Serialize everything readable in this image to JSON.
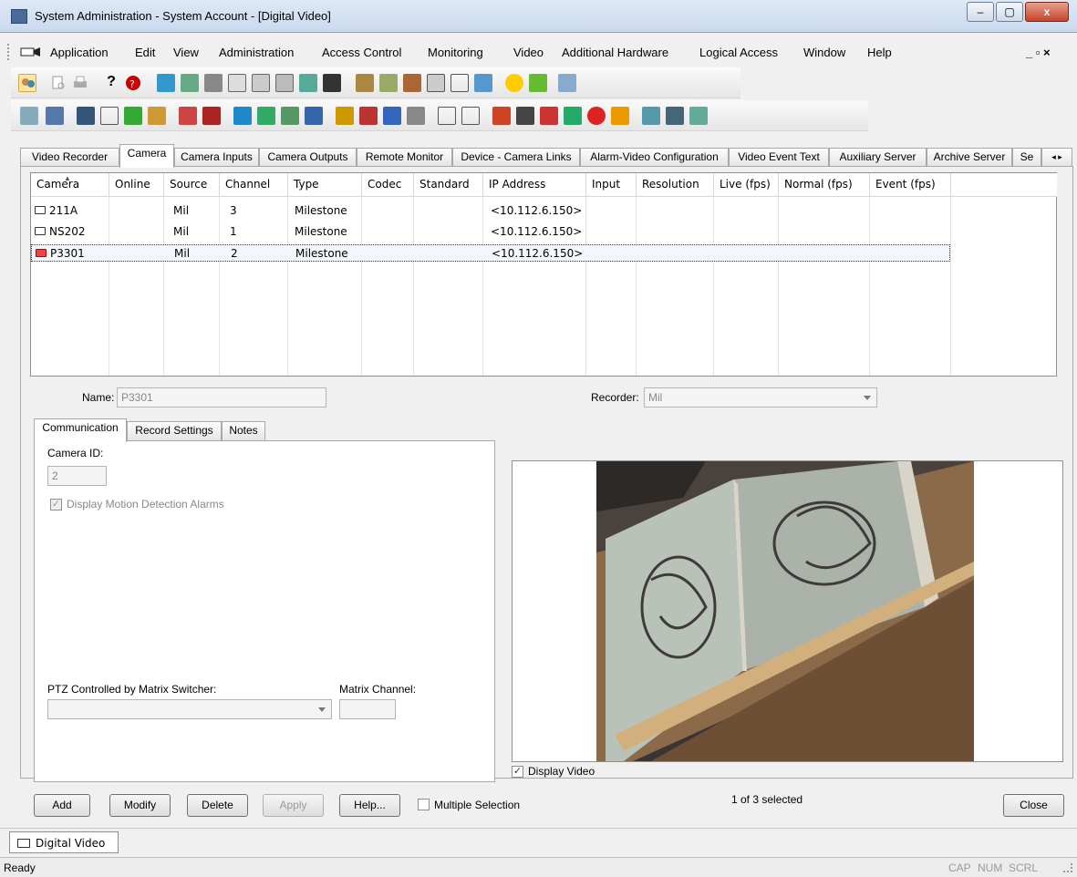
{
  "window": {
    "title": "System Administration - System Account - [Digital Video]",
    "minimize": "–",
    "maximize": "▢",
    "close": "x",
    "mdi_controls": "_ ▫ ×"
  },
  "menu": [
    "Application",
    "Edit",
    "View",
    "Administration",
    "Access Control",
    "Monitoring",
    "Video",
    "Additional Hardware",
    "Logical Access",
    "Window",
    "Help"
  ],
  "tabs": [
    "Video Recorder",
    "Camera",
    "Camera Inputs",
    "Camera Outputs",
    "Remote Monitor",
    "Device - Camera Links",
    "Alarm-Video Configuration",
    "Video Event Text",
    "Auxiliary Server",
    "Archive Server",
    "Se"
  ],
  "tab_scroll": "◂ ▸",
  "grid": {
    "columns": [
      "Camera",
      "Online",
      "Source",
      "Channel",
      "Type",
      "Codec",
      "Standard",
      "IP Address",
      "Input",
      "Resolution",
      "Live (fps)",
      "Normal (fps)",
      "Event (fps)"
    ],
    "rows": [
      {
        "camera": "211A",
        "source": "Mil",
        "channel": "3",
        "type": "Milestone",
        "ip": "<10.112.6.150>",
        "error": false
      },
      {
        "camera": "NS202",
        "source": "Mil",
        "channel": "1",
        "type": "Milestone",
        "ip": "<10.112.6.150>",
        "error": false
      },
      {
        "camera": "P3301",
        "source": "Mil",
        "channel": "2",
        "type": "Milestone",
        "ip": "<10.112.6.150>",
        "error": true
      }
    ]
  },
  "form": {
    "name_label": "Name:",
    "name_value": "P3301",
    "recorder_label": "Recorder:",
    "recorder_value": "Mil",
    "subtabs": [
      "Communication",
      "Record Settings",
      "Notes"
    ],
    "camera_id_label": "Camera ID:",
    "camera_id_value": "2",
    "motion_alarms_label": "Display Motion Detection Alarms",
    "motion_alarms_checked": true,
    "ptz_label": "PTZ Controlled by Matrix Switcher:",
    "matrix_channel_label": "Matrix Channel:",
    "display_video_label": "Display Video",
    "display_video_checked": true
  },
  "buttons": {
    "add": "Add",
    "modify": "Modify",
    "delete": "Delete",
    "apply": "Apply",
    "help": "Help...",
    "multiple_selection": "Multiple Selection",
    "selection_status": "1 of 3 selected",
    "close": "Close"
  },
  "doc_tab": "Digital Video",
  "status": {
    "text": "Ready",
    "cap": "CAP",
    "num": "NUM",
    "scrl": "SCRL"
  }
}
